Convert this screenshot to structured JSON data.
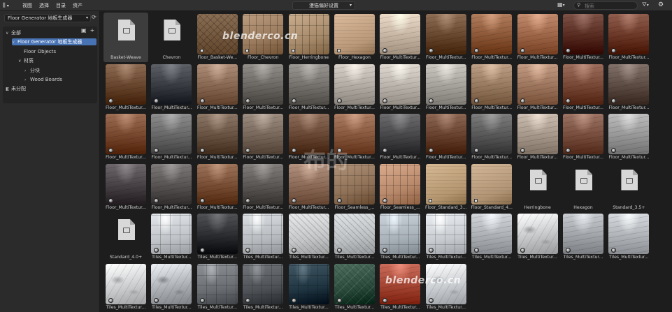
{
  "header": {
    "menus": [
      "视图",
      "选择",
      "目录",
      "资产"
    ],
    "library": "漫猫偏好设置",
    "search_placeholder": "搜索"
  },
  "sidebar": {
    "catalog": "Floor Generator 地板生成器",
    "tree": [
      {
        "label": "全部",
        "indent": 0,
        "arrow": "down"
      },
      {
        "label": "Floor Generator 地板生成器",
        "indent": 1,
        "arrow": "down",
        "selected": true
      },
      {
        "label": "Floor Objects",
        "indent": 2,
        "arrow": ""
      },
      {
        "label": "材质",
        "indent": 2,
        "arrow": "down"
      },
      {
        "label": "分块",
        "indent": 3,
        "arrow": "right"
      },
      {
        "label": "Wood Boards",
        "indent": 3,
        "arrow": "right"
      },
      {
        "label": "未分配",
        "indent": 0,
        "arrow": ""
      }
    ]
  },
  "watermarks": {
    "top": "blenderco.cn",
    "bottom": "blenderco.cn",
    "center": "布的"
  },
  "assets": [
    {
      "label": "Basket-Weave",
      "kind": "file",
      "selected": true
    },
    {
      "label": "Chevron",
      "kind": "file"
    },
    {
      "label": "Floor_Basket-We...",
      "kind": "tex",
      "tone": "#8a6e54",
      "pattern": "basket",
      "badge": "sq"
    },
    {
      "label": "Floor_Chevron",
      "kind": "tex",
      "tone": "#9a7a5c",
      "pattern": "planks",
      "badge": "sq"
    },
    {
      "label": "Floor_Herringbone",
      "kind": "tex",
      "tone": "#a68a6a",
      "pattern": "planks",
      "badge": "sq"
    },
    {
      "label": "Floor_Hexagon",
      "kind": "tex",
      "tone": "#b89878",
      "pattern": "flat",
      "badge": "sq"
    },
    {
      "label": "Floor_MultiTextur...",
      "kind": "tex",
      "tone": "#c9b8a6",
      "pattern": "shine"
    },
    {
      "label": "Floor_MultiTextur...",
      "kind": "tex",
      "tone": "#6a4a30",
      "pattern": "shine"
    },
    {
      "label": "Floor_MultiTextur...",
      "kind": "tex",
      "tone": "#8e5a3a",
      "pattern": "shine"
    },
    {
      "label": "Floor_MultiTextur...",
      "kind": "tex",
      "tone": "#a0684a",
      "pattern": "shine"
    },
    {
      "label": "Floor_MultiTextur...",
      "kind": "tex",
      "tone": "#5a2e22",
      "pattern": "shine"
    },
    {
      "label": "Floor_MultiTextur...",
      "kind": "tex",
      "tone": "#6e3a2a",
      "pattern": "shine"
    },
    {
      "label": "Floor_MultiTextur...",
      "kind": "tex",
      "tone": "#6a4830",
      "pattern": "shine"
    },
    {
      "label": "Floor_MultiTextur...",
      "kind": "tex",
      "tone": "#3a3e44",
      "pattern": "shine"
    },
    {
      "label": "Floor_MultiTextur...",
      "kind": "tex",
      "tone": "#8a6a54",
      "pattern": "shine"
    },
    {
      "label": "Floor_MultiTextur...",
      "kind": "tex",
      "tone": "#6e6a66",
      "pattern": "shine"
    },
    {
      "label": "Floor_MultiTextur...",
      "kind": "tex",
      "tone": "#77736e",
      "pattern": "shine"
    },
    {
      "label": "Floor_MultiTextur...",
      "kind": "tex",
      "tone": "#b4aea6",
      "pattern": "shine"
    },
    {
      "label": "Floor_MultiTextur...",
      "kind": "tex",
      "tone": "#bcb6ae",
      "pattern": "shine"
    },
    {
      "label": "Floor_MultiTextur...",
      "kind": "tex",
      "tone": "#a8a49e",
      "pattern": "shine"
    },
    {
      "label": "Floor_MultiTextur...",
      "kind": "tex",
      "tone": "#9a7c62",
      "pattern": "shine"
    },
    {
      "label": "Floor_MultiTextur...",
      "kind": "tex",
      "tone": "#a07860",
      "pattern": "shine"
    },
    {
      "label": "Floor_MultiTextur...",
      "kind": "tex",
      "tone": "#7a4a38",
      "pattern": "shine"
    },
    {
      "label": "Floor_MultiTextur...",
      "kind": "tex",
      "tone": "#5e4e46",
      "pattern": "shine"
    },
    {
      "label": "Floor_MultiTextur...",
      "kind": "tex",
      "tone": "#7a4a30",
      "pattern": "shine"
    },
    {
      "label": "Floor_MultiTextur...",
      "kind": "tex",
      "tone": "#6a6a6a",
      "pattern": "shine"
    },
    {
      "label": "Floor_MultiTextur...",
      "kind": "tex",
      "tone": "#6a5444",
      "pattern": "shine"
    },
    {
      "label": "Floor_MultiTextur...",
      "kind": "tex",
      "tone": "#7a6a5e",
      "pattern": "shine"
    },
    {
      "label": "Floor_MultiTextur...",
      "kind": "tex",
      "tone": "#6a4a36",
      "pattern": "shine"
    },
    {
      "label": "Floor_MultiTextur...",
      "kind": "tex",
      "tone": "#8a5a40",
      "pattern": "shine"
    },
    {
      "label": "Floor_MultiTextur...",
      "kind": "tex",
      "tone": "#4a4a4c",
      "pattern": "shine"
    },
    {
      "label": "Floor_MultiTextur...",
      "kind": "tex",
      "tone": "#6a4430",
      "pattern": "shine"
    },
    {
      "label": "Floor_MultiTextur...",
      "kind": "tex",
      "tone": "#5a5a5a",
      "pattern": "shine"
    },
    {
      "label": "Floor_MultiTextur...",
      "kind": "tex",
      "tone": "#a89a8c",
      "pattern": "shine"
    },
    {
      "label": "Floor_MultiTextur...",
      "kind": "tex",
      "tone": "#7a5040",
      "pattern": "shine"
    },
    {
      "label": "Floor_MultiTextur...",
      "kind": "tex",
      "tone": "#9a9a9a",
      "pattern": "shine"
    },
    {
      "label": "Floor_MultiTextur...",
      "kind": "tex",
      "tone": "#4a4448",
      "pattern": "shine"
    },
    {
      "label": "Floor_MultiTextur...",
      "kind": "tex",
      "tone": "#5a5656",
      "pattern": "shine"
    },
    {
      "label": "Floor_MultiTextur...",
      "kind": "tex",
      "tone": "#7a5036",
      "pattern": "shine"
    },
    {
      "label": "Floor_MultiTextur...",
      "kind": "tex",
      "tone": "#5e5a58",
      "pattern": "shine"
    },
    {
      "label": "Floor_MultiTextur...",
      "kind": "tex",
      "tone": "#8e6e5a",
      "pattern": "shine"
    },
    {
      "label": "Floor_Seamless_...",
      "kind": "tex",
      "tone": "#8e7056",
      "pattern": "planks"
    },
    {
      "label": "Floor_Seamless_...",
      "kind": "tex",
      "tone": "#b8886a",
      "pattern": "planks"
    },
    {
      "label": "Floor_Standard_3...",
      "kind": "tex",
      "tone": "#b49670",
      "pattern": "flat",
      "badge": "sq"
    },
    {
      "label": "Floor_Standard_4...",
      "kind": "tex",
      "tone": "#b09474",
      "pattern": "flat",
      "badge": "sq"
    },
    {
      "label": "Herringbone",
      "kind": "file"
    },
    {
      "label": "Hexagon",
      "kind": "file"
    },
    {
      "label": "Standard_3.5+",
      "kind": "file"
    },
    {
      "label": "Standard_4.0+",
      "kind": "file"
    },
    {
      "label": "Tiles_MultiTextur...",
      "kind": "tex",
      "tone": "#c0c4c8",
      "pattern": "tiles"
    },
    {
      "label": "Tiles_MultiTextur...",
      "kind": "tex",
      "tone": "#2e3034",
      "pattern": "shine"
    },
    {
      "label": "Tiles_MultiTextur...",
      "kind": "tex",
      "tone": "#b8bcc0",
      "pattern": "tiles"
    },
    {
      "label": "Tiles_MultiTextur...",
      "kind": "tex",
      "tone": "#c4c6c8",
      "pattern": "herring"
    },
    {
      "label": "Tiles_MultiTextur...",
      "kind": "tex",
      "tone": "#bcc0c2",
      "pattern": "herring"
    },
    {
      "label": "Tiles_MultiTextur...",
      "kind": "tex",
      "tone": "#a8b0b8",
      "pattern": "tiles"
    },
    {
      "label": "Tiles_MultiTextur...",
      "kind": "tex",
      "tone": "#c8ccd0",
      "pattern": "tiles"
    },
    {
      "label": "Tiles_MultiTextur...",
      "kind": "tex",
      "tone": "#b0b4b8",
      "pattern": "shine"
    },
    {
      "label": "Tiles_MultiTextur...",
      "kind": "tex",
      "tone": "#c0c2c4",
      "pattern": "marble"
    },
    {
      "label": "Tiles_MultiTextur...",
      "kind": "tex",
      "tone": "#a4a8ac",
      "pattern": "shine"
    },
    {
      "label": "Tiles_MultiTextur...",
      "kind": "tex",
      "tone": "#b4b8bc",
      "pattern": "shine"
    },
    {
      "label": "Tiles_MultiTextur...",
      "kind": "tex",
      "tone": "#c8cacc",
      "pattern": "marble"
    },
    {
      "label": "Tiles_MultiTextur...",
      "kind": "tex",
      "tone": "#a8acb0",
      "pattern": "marble"
    },
    {
      "label": "Tiles_MultiTextur...",
      "kind": "tex",
      "tone": "#6a6e72",
      "pattern": "tiles"
    },
    {
      "label": "Tiles_MultiTextur...",
      "kind": "tex",
      "tone": "#4e5256",
      "pattern": "tiles"
    },
    {
      "label": "Tiles_MultiTextur...",
      "kind": "tex",
      "tone": "#1e3440",
      "pattern": "tiles"
    },
    {
      "label": "Tiles_MultiTextur...",
      "kind": "tex",
      "tone": "#2a4a3c",
      "pattern": "herring"
    },
    {
      "label": "Tiles_MultiTextur...",
      "kind": "tex",
      "tone": "#a84836",
      "pattern": "shine"
    },
    {
      "label": "Tiles_MultiTextur...",
      "kind": "tex",
      "tone": "#c4c8cc",
      "pattern": "marble"
    }
  ]
}
